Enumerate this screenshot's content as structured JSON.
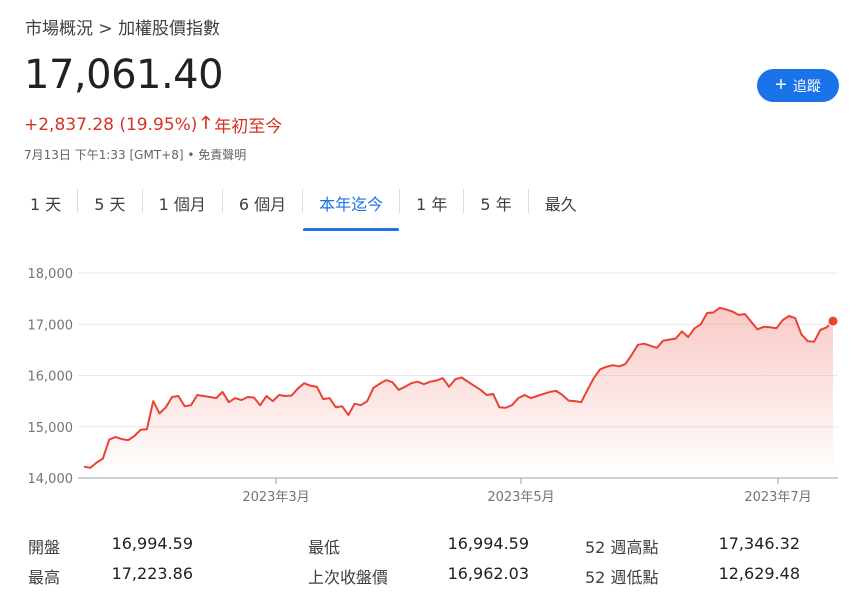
{
  "breadcrumb": {
    "parent": "市場概況",
    "separator": ">",
    "current": "加權股價指數"
  },
  "quote": {
    "price": "17,061.40",
    "change": "+2,837.28 (19.95%)",
    "change_direction": "up",
    "period": "年初至今",
    "timestamp": "7月13日 下午1:33 [GMT+8] • 免責聲明",
    "up_color": "#d93025"
  },
  "follow_button": {
    "label": "追蹤",
    "color": "#1a73e8"
  },
  "tabs": [
    {
      "label": "1 天",
      "active": false
    },
    {
      "label": "5 天",
      "active": false
    },
    {
      "label": "1 個月",
      "active": false
    },
    {
      "label": "6 個月",
      "active": false
    },
    {
      "label": "本年迄今",
      "active": true
    },
    {
      "label": "1 年",
      "active": false
    },
    {
      "label": "5 年",
      "active": false
    },
    {
      "label": "最久",
      "active": false
    }
  ],
  "chart_data": {
    "type": "area",
    "ylim": [
      14000,
      18000
    ],
    "y_ticks": [
      "14,000",
      "15,000",
      "16,000",
      "17,000",
      "18,000"
    ],
    "x_ticks": [
      "2023年3月",
      "2023年5月",
      "2023年7月"
    ],
    "line_color": "#ea4335",
    "values": [
      14220,
      14200,
      14300,
      14380,
      14750,
      14800,
      14760,
      14740,
      14820,
      14940,
      14950,
      15500,
      15260,
      15380,
      15580,
      15600,
      15400,
      15420,
      15620,
      15600,
      15580,
      15560,
      15680,
      15480,
      15560,
      15520,
      15580,
      15570,
      15420,
      15600,
      15500,
      15620,
      15600,
      15610,
      15750,
      15850,
      15800,
      15780,
      15540,
      15560,
      15380,
      15400,
      15230,
      15450,
      15420,
      15500,
      15760,
      15840,
      15910,
      15870,
      15720,
      15780,
      15850,
      15880,
      15830,
      15880,
      15900,
      15950,
      15780,
      15930,
      15960,
      15880,
      15800,
      15720,
      15620,
      15640,
      15380,
      15370,
      15420,
      15560,
      15620,
      15560,
      15600,
      15640,
      15680,
      15700,
      15620,
      15510,
      15500,
      15480,
      15720,
      15950,
      16120,
      16170,
      16200,
      16180,
      16220,
      16400,
      16600,
      16620,
      16580,
      16540,
      16680,
      16700,
      16720,
      16860,
      16750,
      16920,
      17000,
      17220,
      17230,
      17320,
      17290,
      17250,
      17180,
      17200,
      17050,
      16900,
      16950,
      16940,
      16920,
      17080,
      17160,
      17120,
      16800,
      16670,
      16660,
      16890,
      16940,
      17061
    ]
  },
  "stats": [
    {
      "label": "開盤",
      "value": "16,994.59"
    },
    {
      "label": "最高",
      "value": "17,223.86"
    },
    {
      "label": "最低",
      "value": "16,994.59"
    },
    {
      "label": "上次收盤價",
      "value": "16,962.03"
    },
    {
      "label": "52 週高點",
      "value": "17,346.32"
    },
    {
      "label": "52 週低點",
      "value": "12,629.48"
    }
  ]
}
